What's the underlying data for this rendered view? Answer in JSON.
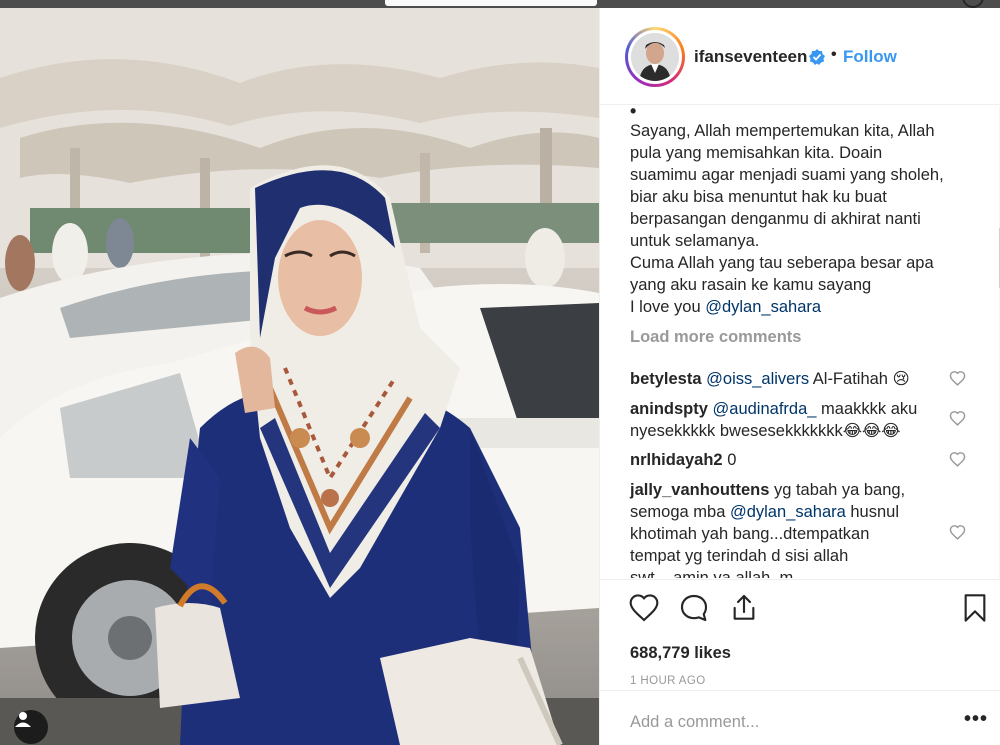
{
  "post": {
    "author": "ifanseventeen",
    "follow_label": "Follow",
    "separator": "•",
    "caption_dot": "•",
    "caption_lines": [
      "Sayang, Allah mempertemukan kita, Allah",
      "pula yang memisahkan kita. Doain",
      "suamimu agar menjadi suami yang sholeh,",
      "biar aku bisa menuntut hak ku buat",
      "berpasangan denganmu di akhirat nanti",
      "untuk selamanya.",
      "Cuma Allah yang tau seberapa besar apa",
      "yang aku rasain ke kamu sayang"
    ],
    "caption_last_prefix": "I love you ",
    "caption_mention": "@dylan_sahara",
    "load_more": "Load more comments",
    "likes": "688,779 likes",
    "time": "1 HOUR AGO",
    "add_comment_placeholder": "Add a comment...",
    "more_glyph": "•••"
  },
  "comments": [
    {
      "user": "betylesta",
      "mention": "@oiss_alivers",
      "text": " Al-Fatihah 😢"
    },
    {
      "user": "anindspty",
      "mention": "@audinafrda_",
      "text": " maakkkk aku",
      "line2": "nyesekkkkk bwesesekkkkkkk😂😂😂"
    },
    {
      "user": "nrlhidayah2",
      "text": " 0"
    },
    {
      "user": "jally_vanhouttens",
      "text": " yg tabah ya bang,",
      "line2_prefix": "semoga mba ",
      "line2_mention": "@dylan_sahara",
      "line2_suffix": " husnul",
      "line3": "khotimah yah bang...dtempatkan",
      "line4": "tempat yg terindah d sisi allah",
      "line5": "swt....amin ya allah..m"
    }
  ],
  "icons": {
    "verified": "verified-badge-icon",
    "like": "heart-icon",
    "comment": "comment-bubble-icon",
    "share": "share-icon",
    "save": "bookmark-icon",
    "tag": "user-tag-icon"
  },
  "colors": {
    "link": "#3897f0",
    "mention": "#003569",
    "muted": "#999999",
    "text": "#262626"
  }
}
